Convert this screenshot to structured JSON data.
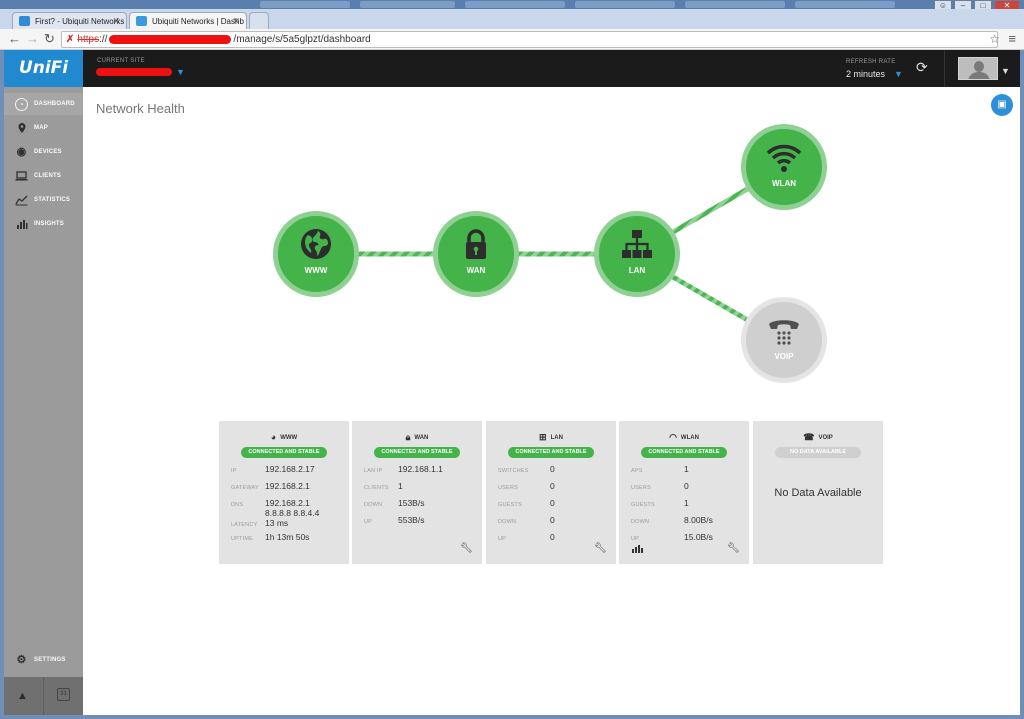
{
  "browser": {
    "tabs": [
      {
        "label": "First? - Ubiquiti Networks"
      },
      {
        "label": "Ubiquiti Networks | Dashb"
      }
    ],
    "url_scheme": "https",
    "url_path": "/manage/s/5a5glpzt/dashboard"
  },
  "header": {
    "logo": "UniFi",
    "current_site_label": "CURRENT SITE",
    "refresh_rate_label": "REFRESH RATE",
    "refresh_rate_value": "2 minutes"
  },
  "sidebar": {
    "items": [
      {
        "label": "DASHBOARD",
        "icon": "dashboard-icon"
      },
      {
        "label": "MAP",
        "icon": "map-pin-icon"
      },
      {
        "label": "DEVICES",
        "icon": "devices-icon"
      },
      {
        "label": "CLIENTS",
        "icon": "laptop-icon"
      },
      {
        "label": "STATISTICS",
        "icon": "line-chart-icon"
      },
      {
        "label": "INSIGHTS",
        "icon": "bar-chart-icon"
      }
    ],
    "settings_label": "SETTINGS"
  },
  "main": {
    "title": "Network Health",
    "nodes": {
      "www": "WWW",
      "wan": "WAN",
      "lan": "LAN",
      "wlan": "WLAN",
      "voip": "VOIP"
    },
    "colors": {
      "ok": "#43b34a",
      "na": "#cfcfcf",
      "accent": "#2d8fd8",
      "logo": "#2089cf"
    },
    "cards": {
      "www": {
        "title": "WWW",
        "status": "CONNECTED AND STABLE",
        "rows": [
          {
            "k": "IP",
            "v": "192.168.2.17"
          },
          {
            "k": "GATEWAY",
            "v": "192.168.2.1"
          },
          {
            "k": "DNS",
            "v": "192.168.2.1"
          },
          {
            "k": "",
            "v": "8.8.8.8 8.8.4.4"
          },
          {
            "k": "LATENCY",
            "v": "13 ms"
          },
          {
            "k": "UPTIME",
            "v": "1h 13m 50s"
          }
        ]
      },
      "wan": {
        "title": "WAN",
        "status": "CONNECTED AND STABLE",
        "rows": [
          {
            "k": "LAN IP",
            "v": "192.168.1.1"
          },
          {
            "k": "CLIENTS",
            "v": "1"
          },
          {
            "k": "DOWN",
            "v": "153B/s"
          },
          {
            "k": "UP",
            "v": "553B/s"
          }
        ]
      },
      "lan": {
        "title": "LAN",
        "status": "CONNECTED AND STABLE",
        "rows": [
          {
            "k": "SWITCHES",
            "v": "0"
          },
          {
            "k": "USERS",
            "v": "0"
          },
          {
            "k": "GUESTS",
            "v": "0"
          },
          {
            "k": "DOWN",
            "v": "0"
          },
          {
            "k": "UP",
            "v": "0"
          }
        ]
      },
      "wlan": {
        "title": "WLAN",
        "status": "CONNECTED AND STABLE",
        "rows": [
          {
            "k": "APS",
            "v": "1"
          },
          {
            "k": "USERS",
            "v": "0"
          },
          {
            "k": "GUESTS",
            "v": "1"
          },
          {
            "k": "DOWN",
            "v": "8.00B/s"
          },
          {
            "k": "UP",
            "v": "15.0B/s"
          }
        ]
      },
      "voip": {
        "title": "VOIP",
        "status": "NO DATA AVAILABLE",
        "message": "No Data Available"
      }
    }
  }
}
